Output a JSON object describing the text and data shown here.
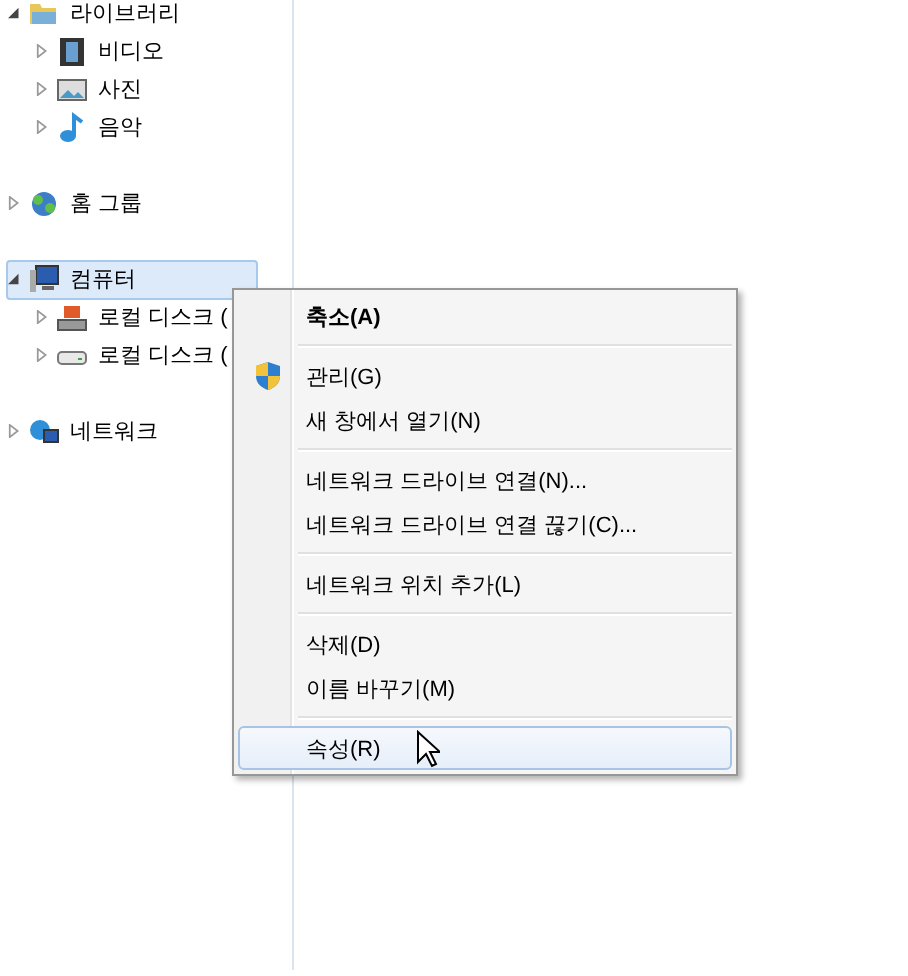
{
  "nav_tree": [
    {
      "label": "라이브러리",
      "kind": "library",
      "expanded": true,
      "selected": false,
      "children": [
        {
          "label": "비디오",
          "kind": "video",
          "expanded": false,
          "selected": false
        },
        {
          "label": "사진",
          "kind": "photo",
          "expanded": false,
          "selected": false
        },
        {
          "label": "음악",
          "kind": "music",
          "expanded": false,
          "selected": false
        }
      ]
    },
    {
      "label": "홈 그룹",
      "kind": "homegroup",
      "expanded": false,
      "selected": false
    },
    {
      "label": "컴퓨터",
      "kind": "computer",
      "expanded": true,
      "selected": true,
      "children": [
        {
          "label": "로컬 디스크 (",
          "kind": "windisk",
          "expanded": false,
          "selected": false
        },
        {
          "label": "로컬 디스크 (",
          "kind": "disk",
          "expanded": false,
          "selected": false
        }
      ]
    },
    {
      "label": "네트워크",
      "kind": "network",
      "expanded": false,
      "selected": false
    }
  ],
  "context_menu": [
    {
      "kind": "item",
      "label": "축소(A)",
      "default": true,
      "selected": false
    },
    {
      "kind": "separator"
    },
    {
      "kind": "shield",
      "label": "관리(G)",
      "default": false,
      "selected": false
    },
    {
      "kind": "item",
      "label": "새 창에서 열기(N)",
      "default": false,
      "selected": false
    },
    {
      "kind": "separator"
    },
    {
      "kind": "item",
      "label": "네트워크 드라이브 연결(N)...",
      "default": false,
      "selected": false
    },
    {
      "kind": "item",
      "label": "네트워크 드라이브 연결 끊기(C)...",
      "default": false,
      "selected": false
    },
    {
      "kind": "separator"
    },
    {
      "kind": "item",
      "label": "네트워크 위치 추가(L)",
      "default": false,
      "selected": false
    },
    {
      "kind": "separator"
    },
    {
      "kind": "item",
      "label": "삭제(D)",
      "default": false,
      "selected": false
    },
    {
      "kind": "item",
      "label": "이름 바꾸기(M)",
      "default": false,
      "selected": false
    },
    {
      "kind": "separator"
    },
    {
      "kind": "item",
      "label": "속성(R)",
      "default": false,
      "selected": true
    }
  ]
}
